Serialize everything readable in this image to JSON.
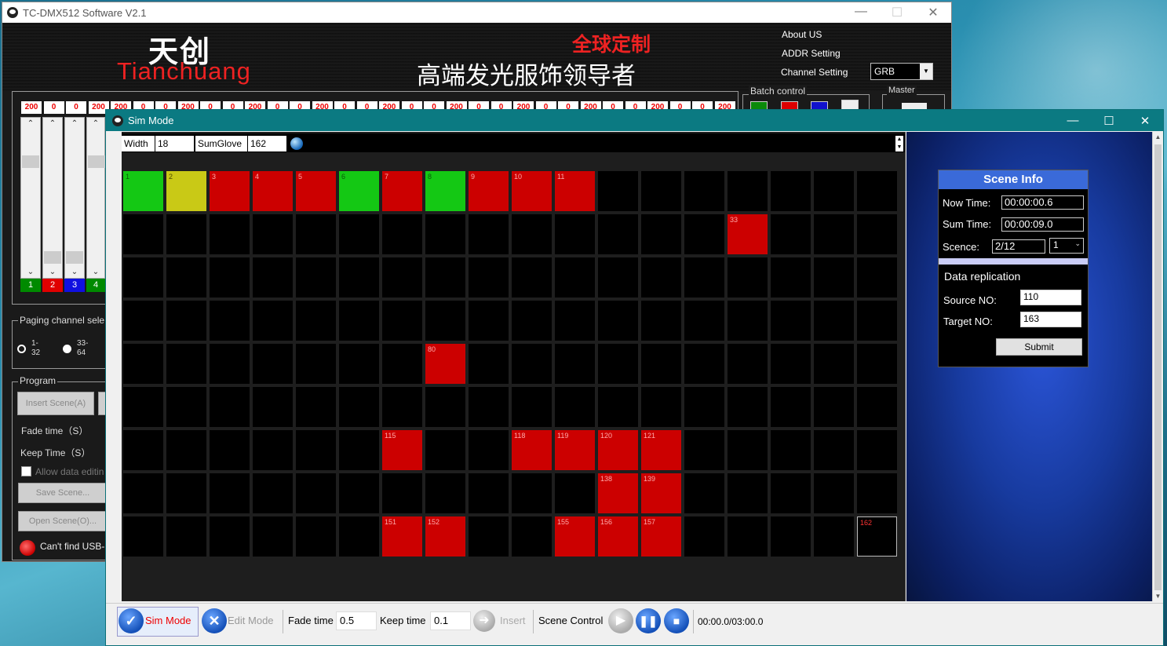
{
  "main_window": {
    "title": "TC-DMX512 Software V2.1",
    "logo_cn": "天创",
    "logo_en": "Tianchuang",
    "slogan_red": "全球定制",
    "slogan_white": "高端发光服饰领导者",
    "menu": {
      "about": "About US",
      "addr": "ADDR Setting",
      "channel": "Channel Setting"
    },
    "channel_setting_value": "GRB",
    "batch_control_label": "Batch control",
    "master_label": "Master",
    "fader_values": [
      "200",
      "0",
      "0",
      "200",
      "200",
      "0",
      "0",
      "200",
      "0",
      "0",
      "200",
      "0",
      "0",
      "200",
      "0",
      "0",
      "200",
      "0",
      "0",
      "200",
      "0",
      "0",
      "200",
      "0",
      "0",
      "200",
      "0",
      "0",
      "200",
      "0",
      "0",
      "200"
    ],
    "fader_numbers": [
      {
        "label": "1",
        "color": "#008a00"
      },
      {
        "label": "2",
        "color": "#e00000"
      },
      {
        "label": "3",
        "color": "#1010e0"
      },
      {
        "label": "4",
        "color": "#008a00"
      }
    ],
    "paging_label": "Paging channel sele",
    "paging_opt1": "1-\n32",
    "paging_opt2": "33-\n64",
    "program_label": "Program",
    "insert_scene_btn": "Insert Scene(A)",
    "fade_time_label": "Fade time（S）",
    "keep_time_label": "Keep Time（S）",
    "allow_editing_label": "Allow data editin",
    "save_scene_btn": "Save Scene...",
    "open_scene_btn": "Open Scene(O)...",
    "usb_status": "Can't find USB-"
  },
  "sim_window": {
    "title": "Sim Mode",
    "width_label": "Width",
    "width_value": "18",
    "sumglove_label": "SumGlove",
    "sumglove_value": "162",
    "grid": {
      "columns": 18,
      "rows": 9,
      "cells": [
        {
          "n": 1,
          "label": "1",
          "color": "green"
        },
        {
          "n": 2,
          "label": "2",
          "color": "yellow"
        },
        {
          "n": 3,
          "label": "3",
          "color": "red"
        },
        {
          "n": 4,
          "label": "4",
          "color": "red"
        },
        {
          "n": 5,
          "label": "5",
          "color": "red"
        },
        {
          "n": 6,
          "label": "6",
          "color": "green"
        },
        {
          "n": 7,
          "label": "7",
          "color": "red"
        },
        {
          "n": 8,
          "label": "8",
          "color": "green"
        },
        {
          "n": 9,
          "label": "9",
          "color": "red"
        },
        {
          "n": 10,
          "label": "10",
          "color": "red"
        },
        {
          "n": 11,
          "label": "11",
          "color": "red"
        },
        {
          "n": 33,
          "label": "33",
          "color": "red"
        },
        {
          "n": 80,
          "label": "80",
          "color": "red"
        },
        {
          "n": 115,
          "label": "115",
          "color": "red"
        },
        {
          "n": 118,
          "label": "118",
          "color": "red"
        },
        {
          "n": 119,
          "label": "119",
          "color": "red"
        },
        {
          "n": 120,
          "label": "120",
          "color": "red"
        },
        {
          "n": 121,
          "label": "121",
          "color": "red"
        },
        {
          "n": 138,
          "label": "138",
          "color": "red"
        },
        {
          "n": 139,
          "label": "139",
          "color": "red"
        },
        {
          "n": 151,
          "label": "151",
          "color": "red"
        },
        {
          "n": 152,
          "label": "152",
          "color": "red"
        },
        {
          "n": 155,
          "label": "155",
          "color": "red"
        },
        {
          "n": 156,
          "label": "156",
          "color": "red"
        },
        {
          "n": 157,
          "label": "157",
          "color": "red"
        },
        {
          "n": 162,
          "label": "162",
          "color": "outline"
        }
      ]
    },
    "scene_info": {
      "title": "Scene Info",
      "now_time_label": "Now Time:",
      "now_time_value": "00:00:00.6",
      "sum_time_label": "Sum Time:",
      "sum_time_value": "00:00:09.0",
      "scene_label": "Scence:",
      "scene_value": "2/12",
      "scene_select": "1",
      "replication_label": "Data replication",
      "source_label": "Source NO:",
      "source_value": "110",
      "target_label": "Target NO:",
      "target_value": "163",
      "submit_btn": "Submit"
    },
    "bottom": {
      "sim_mode": "Sim Mode",
      "edit_mode": "Edit Mode",
      "fade_time_label": "Fade time",
      "fade_time_value": "0.5",
      "keep_time_label": "Keep time",
      "keep_time_value": "0.1",
      "insert": "Insert",
      "scene_control": "Scene Control",
      "time_readout": "00:00.0/03:00.0"
    }
  }
}
